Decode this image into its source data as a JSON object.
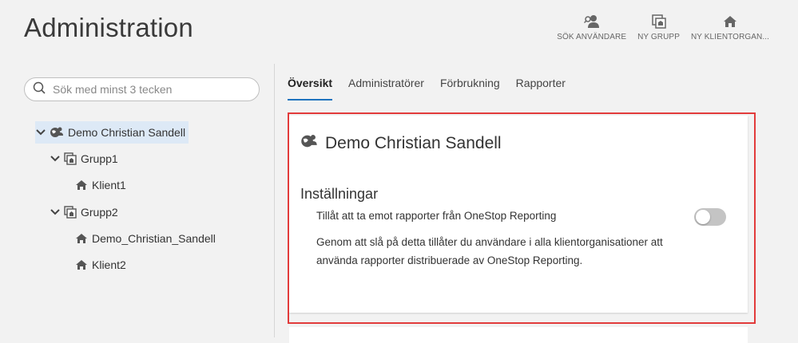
{
  "header": {
    "title": "Administration"
  },
  "top_actions": [
    {
      "label": "SÖK ANVÄNDARE",
      "icon": "search-user-icon"
    },
    {
      "label": "NY GRUPP",
      "icon": "new-group-icon"
    },
    {
      "label": "NY KLIENTORGAN...",
      "icon": "new-client-org-icon"
    }
  ],
  "search": {
    "placeholder": "Sök med minst 3 tecken",
    "value": ""
  },
  "tree": [
    {
      "label": "Demo Christian Sandell",
      "icon": "globe-user-icon",
      "expanded": true,
      "selected": true
    },
    {
      "label": "Grupp1",
      "icon": "group-icon",
      "expanded": true
    },
    {
      "label": "Klient1",
      "icon": "house-icon"
    },
    {
      "label": "Grupp2",
      "icon": "group-icon",
      "expanded": true
    },
    {
      "label": "Demo_Christian_Sandell",
      "icon": "house-icon"
    },
    {
      "label": "Klient2",
      "icon": "house-icon"
    }
  ],
  "tabs": [
    {
      "label": "Översikt",
      "active": true
    },
    {
      "label": "Administratörer"
    },
    {
      "label": "Förbrukning"
    },
    {
      "label": "Rapporter"
    }
  ],
  "card": {
    "title": "Demo Christian Sandell",
    "section_title": "Inställningar",
    "setting_label": "Tillåt att ta emot rapporter från OneStop Reporting",
    "setting_enabled": false,
    "description": "Genom att slå på detta tillåter du användare i alla klientorganisationer att använda rapporter distribuerade av OneStop Reporting."
  },
  "colors": {
    "accent": "#1e73be",
    "highlight_border": "#e23b3b",
    "selected_bg": "#dde9f6",
    "toggle_off": "#c4c4c4"
  }
}
